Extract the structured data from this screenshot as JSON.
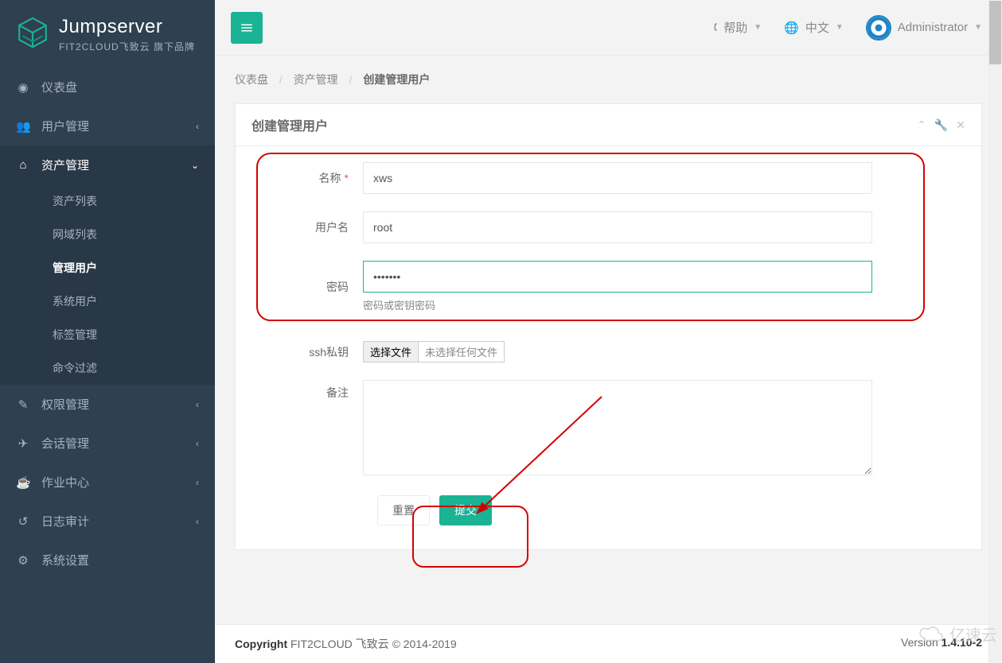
{
  "brand": {
    "name": "Jumpserver",
    "sub": "FIT2CLOUD飞致云 旗下品牌"
  },
  "sidebar": {
    "items": [
      {
        "icon": "dashboard",
        "label": "仪表盘",
        "chev": false
      },
      {
        "icon": "users",
        "label": "用户管理",
        "chev": true
      },
      {
        "icon": "asset",
        "label": "资产管理",
        "chev": true,
        "active": true,
        "sub": [
          {
            "label": "资产列表"
          },
          {
            "label": "网域列表"
          },
          {
            "label": "管理用户",
            "active": true
          },
          {
            "label": "系统用户"
          },
          {
            "label": "标签管理"
          },
          {
            "label": "命令过滤"
          }
        ]
      },
      {
        "icon": "perm",
        "label": "权限管理",
        "chev": true
      },
      {
        "icon": "session",
        "label": "会话管理",
        "chev": true
      },
      {
        "icon": "jobs",
        "label": "作业中心",
        "chev": true
      },
      {
        "icon": "audit",
        "label": "日志审计",
        "chev": true
      },
      {
        "icon": "settings",
        "label": "系统设置",
        "chev": false
      }
    ]
  },
  "topbar": {
    "help": "帮助",
    "lang": "中文",
    "user": "Administrator"
  },
  "breadcrumbs": {
    "root": "仪表盘",
    "mid": "资产管理",
    "current": "创建管理用户"
  },
  "panel": {
    "title": "创建管理用户"
  },
  "form": {
    "name_label": "名称",
    "name_value": "xws",
    "user_label": "用户名",
    "user_value": "root",
    "pwd_label": "密码",
    "pwd_value": "•••••••",
    "pwd_help": "密码或密钥密码",
    "ssh_label": "ssh私钥",
    "file_btn": "选择文件",
    "file_status": "未选择任何文件",
    "note_label": "备注",
    "reset": "重置",
    "submit": "提交"
  },
  "footer": {
    "copyright_label": "Copyright",
    "copyright_text": "FIT2CLOUD 飞致云 © 2014-2019",
    "version_label": "Version",
    "version_value": "1.4.10-2"
  },
  "watermark": "亿速云"
}
